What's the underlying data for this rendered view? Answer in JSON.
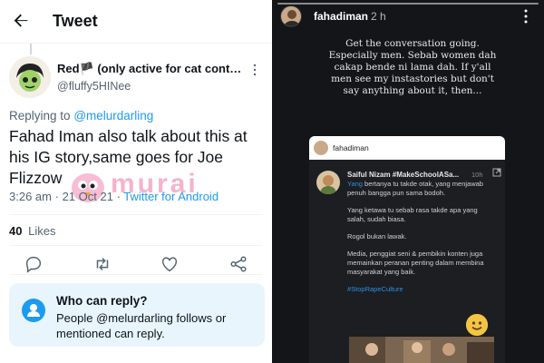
{
  "twitter": {
    "header": {
      "title": "Tweet"
    },
    "tweet": {
      "author_name": "Red🏴 (only active for cat conte...",
      "author_handle": "@fluffy5HINee",
      "replying_label": "Replying to",
      "replying_to": "@melurdarling",
      "text": "Fahad Iman also talk about this at his IG story,same goes for Joe Flizzow",
      "time": "3:26 am",
      "date": "21 Oct 21",
      "source": "Twitter for Android",
      "likes_count": "40",
      "likes_label": "Likes"
    },
    "who_can_reply": {
      "title": "Who can reply?",
      "description": "People @melurdarling follows or mentioned can reply."
    },
    "watermark": "murai",
    "colors": {
      "accent": "#1d9bf0",
      "text": "#0f1419",
      "muted": "#536471"
    }
  },
  "instagram": {
    "username": "fahadiman",
    "time": "2 h",
    "story_text": "Get the conversation going. Especially men. Sebab women dah cakap bende ni lama dah. If y'all men see my instastories but don't say anything about it, then...",
    "embed": {
      "header_username": "fahadiman",
      "comment_author": "Saiful Nizam #MakeSchoolASa...",
      "comment_time": "10h",
      "comment_paragraphs": [
        {
          "highlight": "Yang",
          "text": " bertanya tu takde otak, yang menjawab penuh bangga pun sama bodoh."
        },
        {
          "highlight": "",
          "text": "Yang ketawa tu sebab rasa takde apa yang salah, sudah biasa."
        },
        {
          "highlight": "",
          "text": "Rogol bukan lawak."
        },
        {
          "highlight": "",
          "text": "Media, penggiat seni & pembikin konten juga memainkan peranan penting dalam membina masyarakat yang baik."
        }
      ],
      "hashtag": "#StopRapeCulture"
    },
    "colors": {
      "background": "#141518",
      "link": "#2f8ee0"
    }
  }
}
